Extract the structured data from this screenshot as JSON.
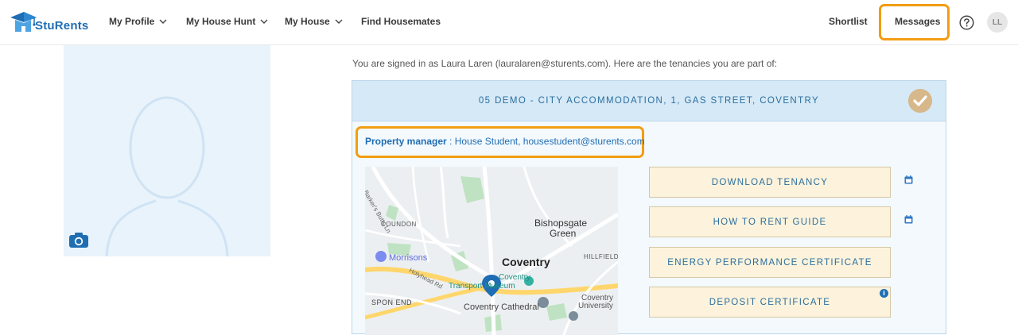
{
  "brand": {
    "name": "StuRents",
    "logo_icon": "graduation-cap-house-icon"
  },
  "nav": {
    "my_profile": "My Profile",
    "my_house_hunt": "My House Hunt",
    "my_house": "My House",
    "find_housemates": "Find Housemates",
    "shortlist": "Shortlist",
    "messages": "Messages",
    "help_icon": "question-circle-icon",
    "avatar_initials": "LL"
  },
  "profile": {
    "camera_icon": "camera-icon",
    "placeholder_icon": "person-silhouette-icon"
  },
  "main": {
    "signed_in_text": "You are signed in as Laura Laren (lauralaren@sturents.com). Here are the tenancies you are part of:",
    "tenancy": {
      "title": "05 DEMO - CITY ACCOMMODATION, 1, GAS STREET, COVENTRY",
      "status_icon": "check-circle-icon",
      "property_manager_label": "Property manager",
      "property_manager_sep": " : ",
      "property_manager_value": "House Student, housestudent@sturents.com",
      "map": {
        "labels": {
          "barkers_butts": "Barker's Butts Ln",
          "coundon": "COUNDON",
          "bishopsgate": "Bishopsgate",
          "green": "Green",
          "morrisons": "Morrisons",
          "hillfield": "HILLFIELD",
          "coventry": "Coventry",
          "museum_a": "Coventry",
          "museum_b": "Transport Museum",
          "holyhead": "Holyhead Rd",
          "spon_end": "SPON END",
          "cathedral": "Coventry Cathedral",
          "university_a": "Coventry",
          "university_b": "University"
        }
      },
      "documents": [
        {
          "label": "DOWNLOAD TENANCY",
          "icon": "calendar-icon"
        },
        {
          "label": "HOW TO RENT GUIDE",
          "icon": "calendar-icon"
        },
        {
          "label": "ENERGY PERFORMANCE CERTIFICATE",
          "icon": ""
        },
        {
          "label": "DEPOSIT CERTIFICATE",
          "icon": "info-icon"
        }
      ]
    }
  },
  "colors": {
    "accent_blue": "#1f6db3",
    "highlight_orange": "#f29d12",
    "button_bg": "#fdf3dc",
    "header_bg": "#d6e9f7"
  }
}
